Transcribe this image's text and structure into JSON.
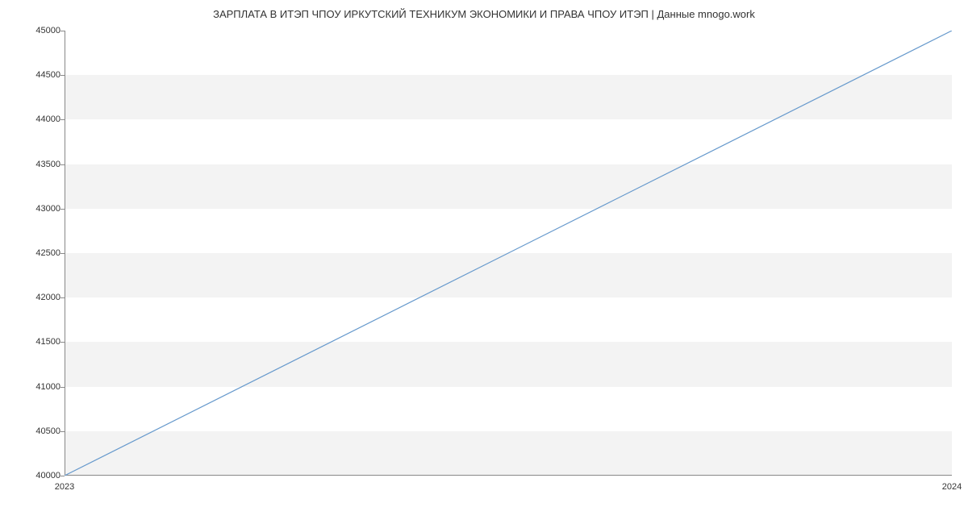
{
  "chart_data": {
    "type": "line",
    "title": "ЗАРПЛАТА В ИТЭП ЧПОУ ИРКУТСКИЙ ТЕХНИКУМ ЭКОНОМИКИ И ПРАВА ЧПОУ ИТЭП | Данные mnogo.work",
    "x": [
      2023,
      2024
    ],
    "values": [
      40000,
      45000
    ],
    "x_ticks": [
      2023,
      2024
    ],
    "y_ticks": [
      40000,
      40500,
      41000,
      41500,
      42000,
      42500,
      43000,
      43500,
      44000,
      44500,
      45000
    ],
    "ylim": [
      40000,
      45000
    ],
    "xlim": [
      2023,
      2024
    ],
    "line_color": "#6699cc"
  }
}
